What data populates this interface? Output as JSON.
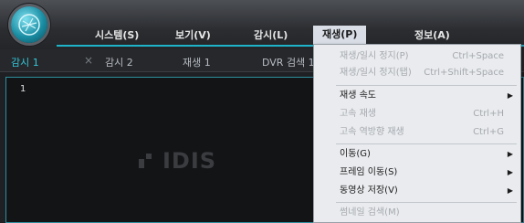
{
  "menubar": {
    "items": [
      "시스템(S)",
      "보기(V)",
      "감시(L)",
      "재생(P)",
      "정보(A)"
    ]
  },
  "tabs": {
    "items": [
      {
        "label": "감시 1",
        "selected": true
      },
      {
        "label": "감시 2"
      },
      {
        "label": "재생 1"
      },
      {
        "label": "DVR 검색 1"
      }
    ],
    "close_glyph": "×"
  },
  "viewer": {
    "channel_number": "1",
    "watermark": "IDIS"
  },
  "playback_menu": {
    "items": [
      {
        "label": "재생/일시 정지(P)",
        "shortcut": "Ctrl+Space",
        "enabled": false
      },
      {
        "label": "재생/일시 정지(탭)",
        "shortcut": "Ctrl+Shift+Space",
        "enabled": false
      },
      {
        "label": "재생 속도",
        "submenu": true,
        "enabled": true
      },
      {
        "label": "고속 재생",
        "shortcut": "Ctrl+H",
        "enabled": false
      },
      {
        "label": "고속 역방향 재생",
        "shortcut": "Ctrl+G",
        "enabled": false
      },
      {
        "label": "이동(G)",
        "submenu": true,
        "enabled": true
      },
      {
        "label": "프레임 이동(S)",
        "submenu": true,
        "enabled": true
      },
      {
        "label": "동영상 저장(V)",
        "submenu": true,
        "enabled": true
      },
      {
        "label": "썸네일 검색(M)",
        "enabled": false
      }
    ],
    "submenu_arrow": "▶"
  },
  "colors": {
    "accent": "#1fb3c9",
    "selected_tab": "#33c6d8"
  }
}
